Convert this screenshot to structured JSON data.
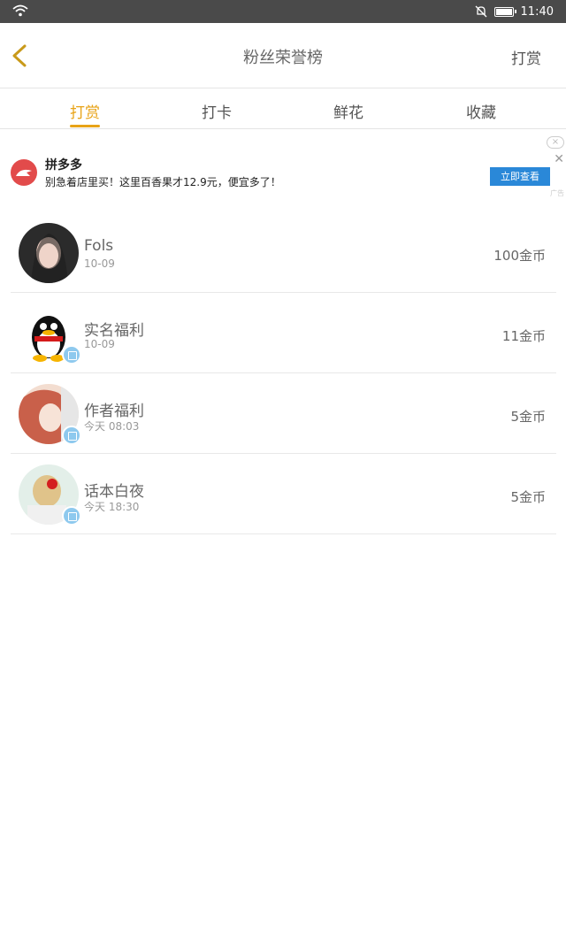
{
  "status_bar": {
    "time": "11:40"
  },
  "header": {
    "title": "粉丝荣誉榜",
    "action_label": "打赏"
  },
  "tabs": [
    {
      "label": "打赏",
      "active": true
    },
    {
      "label": "打卡",
      "active": false
    },
    {
      "label": "鲜花",
      "active": false
    },
    {
      "label": "收藏",
      "active": false
    }
  ],
  "ad": {
    "brand": "拼多多",
    "text": "别急着店里买！这里百香果才12.9元，便宜多了！",
    "button_label": "立即查看",
    "tag": "广告"
  },
  "supporters": [
    {
      "name": "Fols",
      "date": "10-09",
      "amount": "100金币"
    },
    {
      "name": "实名福利",
      "date": "10-09",
      "amount": "11金币"
    },
    {
      "name": "作者福利",
      "date": "今天 08:03",
      "amount": "5金币"
    },
    {
      "name": "话本白夜",
      "date": "今天 18:30",
      "amount": "5金币"
    }
  ],
  "colors": {
    "accent": "#e8a317",
    "status_bar": "#4a4a4a",
    "ad_button": "#2a88d8"
  }
}
